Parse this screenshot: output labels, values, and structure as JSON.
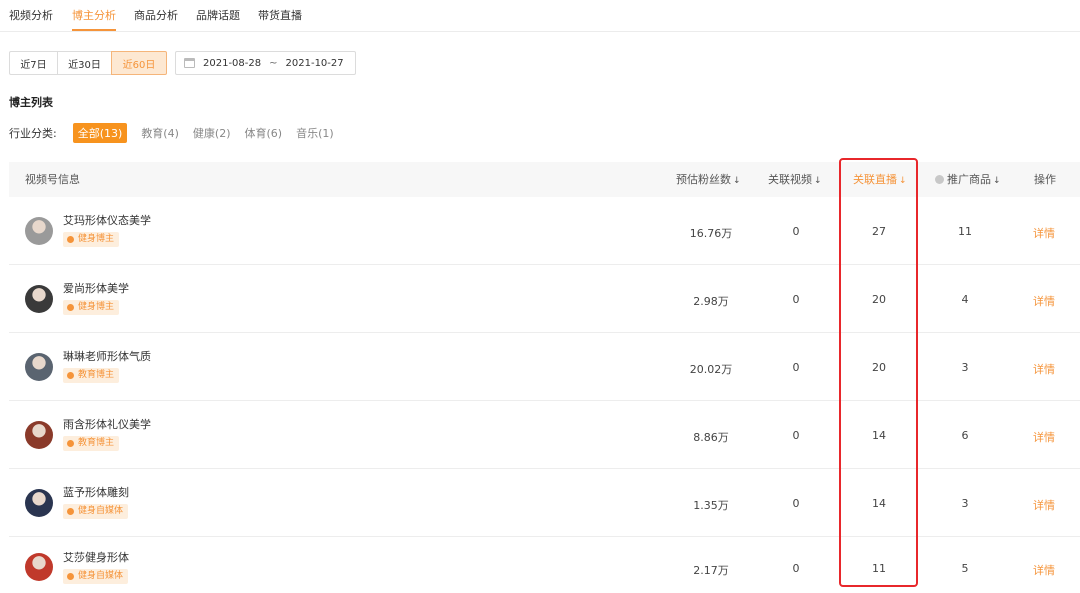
{
  "tabs": [
    {
      "label": "视频分析",
      "active": false
    },
    {
      "label": "博主分析",
      "active": true
    },
    {
      "label": "商品分析",
      "active": false
    },
    {
      "label": "品牌话题",
      "active": false
    },
    {
      "label": "带货直播",
      "active": false
    }
  ],
  "date_range": {
    "buttons": [
      {
        "label": "近7日",
        "active": false
      },
      {
        "label": "近30日",
        "active": false
      },
      {
        "label": "近60日",
        "active": true
      }
    ],
    "start": "2021-08-28",
    "separator": "~",
    "end": "2021-10-27"
  },
  "section_title": "博主列表",
  "filter": {
    "label": "行业分类:",
    "items": [
      {
        "label": "全部(13)",
        "active": true
      },
      {
        "label": "教育(4)",
        "active": false
      },
      {
        "label": "健康(2)",
        "active": false
      },
      {
        "label": "体育(6)",
        "active": false
      },
      {
        "label": "音乐(1)",
        "active": false
      }
    ]
  },
  "table": {
    "headers": {
      "info": "视频号信息",
      "fans": "预估粉丝数",
      "videos": "关联视频",
      "live": "关联直播",
      "products": "推广商品",
      "action": "操作"
    },
    "sort_arrow": "↓",
    "rows": [
      {
        "name": "艾玛形体仪态美学",
        "tag": "健身博主",
        "fans": "16.76万",
        "videos": "0",
        "live": "27",
        "products": "11",
        "action": "详情",
        "avatar_color": "#9a9a9a"
      },
      {
        "name": "爱尚形体美学",
        "tag": "健身博主",
        "fans": "2.98万",
        "videos": "0",
        "live": "20",
        "products": "4",
        "action": "详情",
        "avatar_color": "#3a3a3a"
      },
      {
        "name": "琳琳老师形体气质",
        "tag": "教育博主",
        "fans": "20.02万",
        "videos": "0",
        "live": "20",
        "products": "3",
        "action": "详情",
        "avatar_color": "#5a6470"
      },
      {
        "name": "雨含形体礼仪美学",
        "tag": "教育博主",
        "fans": "8.86万",
        "videos": "0",
        "live": "14",
        "products": "6",
        "action": "详情",
        "avatar_color": "#8a3a2a"
      },
      {
        "name": "蓝予形体雕刻",
        "tag": "健身自媒体",
        "fans": "1.35万",
        "videos": "0",
        "live": "14",
        "products": "3",
        "action": "详情",
        "avatar_color": "#2a3550"
      },
      {
        "name": "艾莎健身形体",
        "tag": "健身自媒体",
        "fans": "2.17万",
        "videos": "0",
        "live": "11",
        "products": "5",
        "action": "详情",
        "avatar_color": "#c0392b"
      }
    ]
  },
  "colors": {
    "accent": "#f5943a",
    "highlight_box": "#e8272b"
  }
}
